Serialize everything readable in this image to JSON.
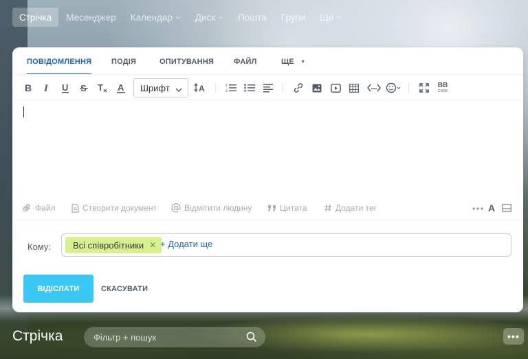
{
  "topnav": {
    "items": [
      {
        "label": "Стрічка",
        "active": true,
        "has_dropdown": false
      },
      {
        "label": "Месенджер",
        "active": false,
        "has_dropdown": false
      },
      {
        "label": "Календар",
        "active": false,
        "has_dropdown": true
      },
      {
        "label": "Диск",
        "active": false,
        "has_dropdown": true
      },
      {
        "label": "Пошта",
        "active": false,
        "has_dropdown": false
      },
      {
        "label": "Групи",
        "active": false,
        "has_dropdown": false
      },
      {
        "label": "Ще",
        "active": false,
        "has_dropdown": true
      }
    ]
  },
  "composer": {
    "tabs": [
      {
        "label": "ПОВІДОМЛЕННЯ",
        "active": true
      },
      {
        "label": "ПОДІЯ",
        "active": false
      },
      {
        "label": "ОПИТУВАННЯ",
        "active": false
      },
      {
        "label": "ФАЙЛ",
        "active": false
      },
      {
        "label": "ЩЕ",
        "active": false
      }
    ],
    "toolbar": {
      "font_select": "Шрифт",
      "bbcode_label_top": "BB",
      "bbcode_label_bottom": "CODE",
      "icons": [
        "bold-icon",
        "italic-icon",
        "underline-icon",
        "strikethrough-icon",
        "clear-format-icon",
        "text-color-icon",
        "font-size-icon",
        "numbered-list-icon",
        "bullet-list-icon",
        "align-icon",
        "link-icon",
        "image-icon",
        "video-icon",
        "table-icon",
        "code-icon",
        "emoji-icon",
        "fullscreen-icon",
        "bbcode-icon"
      ]
    },
    "attach": {
      "file": "Файл",
      "create_doc": "Створити документ",
      "mention": "Відмітити людину",
      "quote": "Цитата",
      "tag": "Додати тег",
      "more_icon": "ellipsis-icon",
      "text_icon": "A"
    },
    "recipients": {
      "label": "Кому:",
      "chip": "Всі співробітники",
      "add_more": "+ Додати ще"
    },
    "actions": {
      "send": "ВІДІСЛАТИ",
      "cancel": "СКАСУВАТИ"
    },
    "colors": {
      "accent": "#2067b0",
      "send_button": "#3bc8f5",
      "chip": "#d8f08f"
    }
  },
  "page": {
    "title": "Стрічка",
    "filter_placeholder": "Фільтр + пошук",
    "more_button": "•••"
  }
}
